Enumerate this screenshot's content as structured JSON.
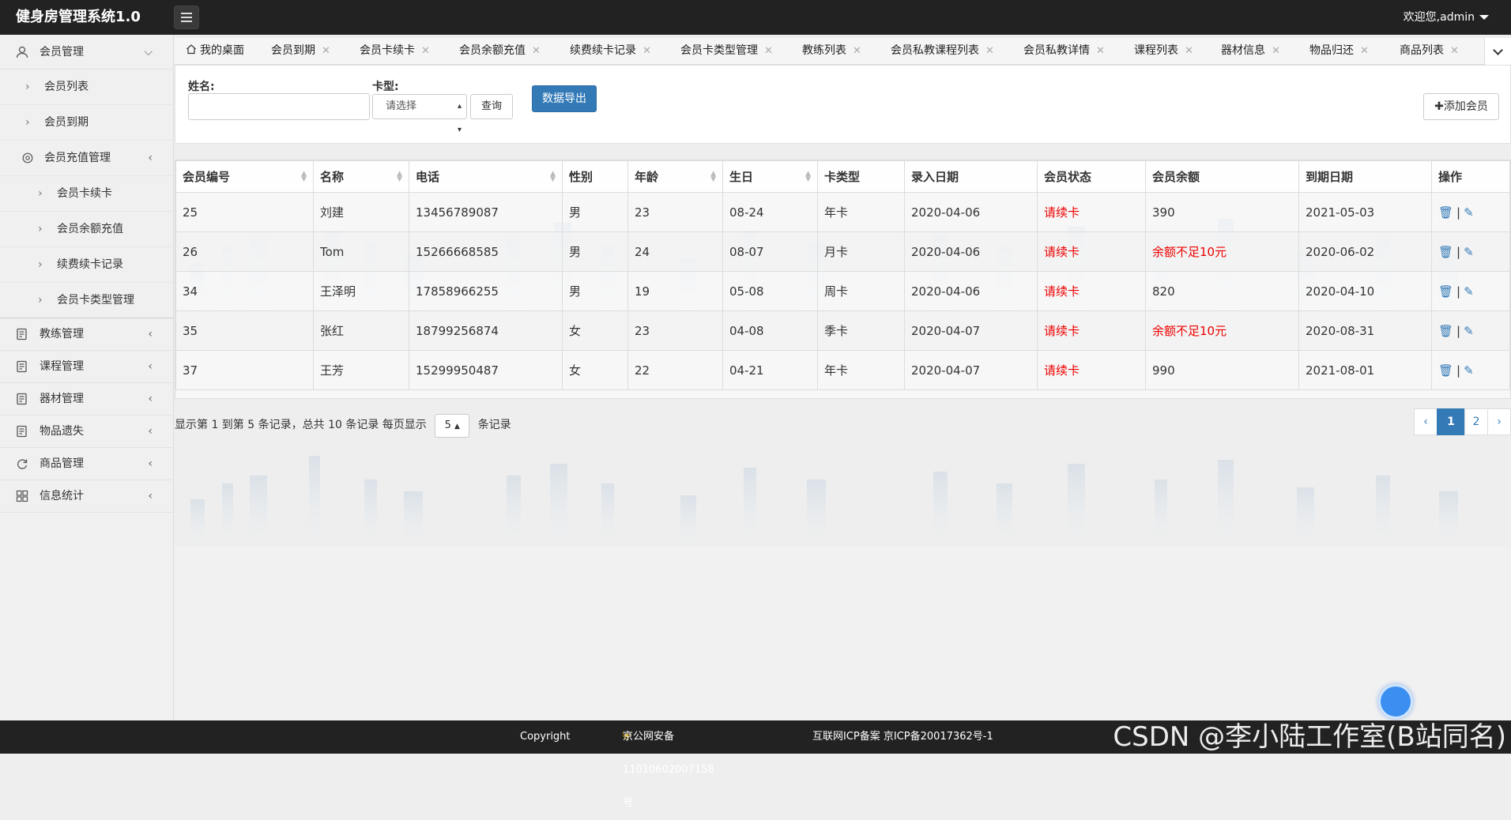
{
  "header": {
    "title": "健身房管理系统1.0",
    "welcome": "欢迎您,admin"
  },
  "sidebar": {
    "member_mgmt": "会员管理",
    "member_list": "会员列表",
    "member_expire": "会员到期",
    "recharge_mgmt": "会员充值管理",
    "recharge_items": [
      "会员卡续卡",
      "会员余额充值",
      "续费续卡记录",
      "会员卡类型管理"
    ],
    "groups": [
      "教练管理",
      "课程管理",
      "器材管理",
      "物品遗失",
      "商品管理",
      "信息统计"
    ]
  },
  "tabs": [
    "我的桌面",
    "会员到期",
    "会员卡续卡",
    "会员余额充值",
    "续费续卡记录",
    "会员卡类型管理",
    "教练列表",
    "会员私教课程列表",
    "会员私教详情",
    "课程列表",
    "器材信息",
    "物品归还",
    "商品列表"
  ],
  "filter": {
    "name_label": "姓名:",
    "card_label": "卡型:",
    "card_select_value": "请选择",
    "query_button": "查询",
    "export_button": "数据导出",
    "add_button": "添加会员"
  },
  "table": {
    "columns": [
      "会员编号",
      "名称",
      "电话",
      "性别",
      "年龄",
      "生日",
      "卡类型",
      "录入日期",
      "会员状态",
      "会员余额",
      "到期日期",
      "操作"
    ],
    "rows": [
      {
        "id": "25",
        "name": "刘建",
        "phone": "13456789087",
        "gender": "男",
        "age": "23",
        "birthday": "08-24",
        "card": "年卡",
        "joined": "2020-04-06",
        "status": "请续卡",
        "balance": "390",
        "expire": "2021-05-03"
      },
      {
        "id": "26",
        "name": "Tom",
        "phone": "15266668585",
        "gender": "男",
        "age": "24",
        "birthday": "08-07",
        "card": "月卡",
        "joined": "2020-04-06",
        "status": "请续卡",
        "balance": "余额不足10元",
        "expire": "2020-06-02"
      },
      {
        "id": "34",
        "name": "王泽明",
        "phone": "17858966255",
        "gender": "男",
        "age": "19",
        "birthday": "05-08",
        "card": "周卡",
        "joined": "2020-04-06",
        "status": "请续卡",
        "balance": "820",
        "expire": "2020-04-10"
      },
      {
        "id": "35",
        "name": "张红",
        "phone": "18799256874",
        "gender": "女",
        "age": "23",
        "birthday": "04-08",
        "card": "季卡",
        "joined": "2020-04-07",
        "status": "请续卡",
        "balance": "余额不足10元",
        "expire": "2020-08-31"
      },
      {
        "id": "37",
        "name": "王芳",
        "phone": "15299950487",
        "gender": "女",
        "age": "22",
        "birthday": "04-21",
        "card": "年卡",
        "joined": "2020-04-07",
        "status": "请续卡",
        "balance": "990",
        "expire": "2021-08-01"
      }
    ]
  },
  "pagination": {
    "info_prefix": "显示第 1 到第 5 条记录，总共 10 条记录 每页显示",
    "page_size": "5",
    "info_suffix": "条记录",
    "pages": [
      "1",
      "2"
    ],
    "prev": "‹",
    "next": "›"
  },
  "footer": {
    "copyright": "Copyright",
    "police": "京公网安备 11010602007158号",
    "icp": "互联网ICP备案 京ICP备20017362号-1",
    "watermark": "CSDN @李小陆工作室(B站同名)"
  },
  "colors": {
    "topbar": "#222222",
    "primary": "#337ab7",
    "warning_text": "#ee0000"
  }
}
